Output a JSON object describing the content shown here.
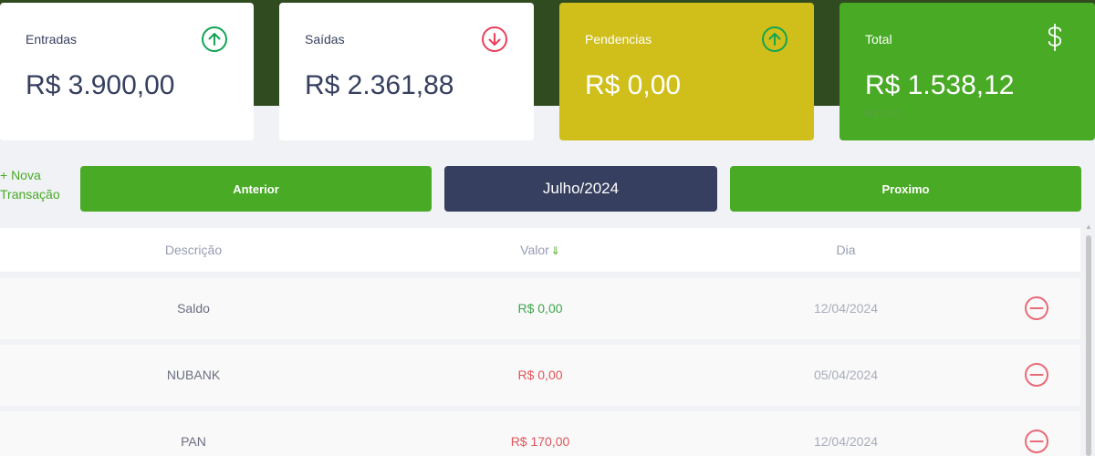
{
  "cards": {
    "entradas": {
      "label": "Entradas",
      "value": "R$ 3.900,00",
      "icon": "arrow-up-circle-icon"
    },
    "saidas": {
      "label": "Saídas",
      "value": "R$ 2.361,88",
      "icon": "arrow-down-circle-icon"
    },
    "pendencias": {
      "label": "Pendencias",
      "value": "R$ 0,00",
      "icon": "arrow-up-circle-icon"
    },
    "total": {
      "label": "Total",
      "value": "R$ 1.538,12",
      "sub": "R$ 0,00",
      "icon": "dollar-icon"
    }
  },
  "actions": {
    "nova_line1": "+ Nova",
    "nova_line2": "Transação",
    "prev_label": "Anterior",
    "month": "Julho/2024",
    "next_label": "Proximo"
  },
  "table": {
    "headers": {
      "descricao": "Descrição",
      "valor": "Valor",
      "dia": "Dia",
      "sort_icon": "⇓"
    },
    "rows": [
      {
        "descricao": "Saldo",
        "valor": "R$ 0,00",
        "dia": "12/04/2024",
        "status": "positive"
      },
      {
        "descricao": "NUBANK",
        "valor": "R$ 0,00",
        "dia": "05/04/2024",
        "status": "negative"
      },
      {
        "descricao": "PAN",
        "valor": "R$ 170,00",
        "dia": "12/04/2024",
        "status": "negative"
      }
    ]
  },
  "colors": {
    "header": "#2f4b1f",
    "green": "#49aa26",
    "yellow": "#d0bf1a",
    "navy": "#363f5f",
    "red": "#e0555a",
    "remove": "#e86b77"
  }
}
